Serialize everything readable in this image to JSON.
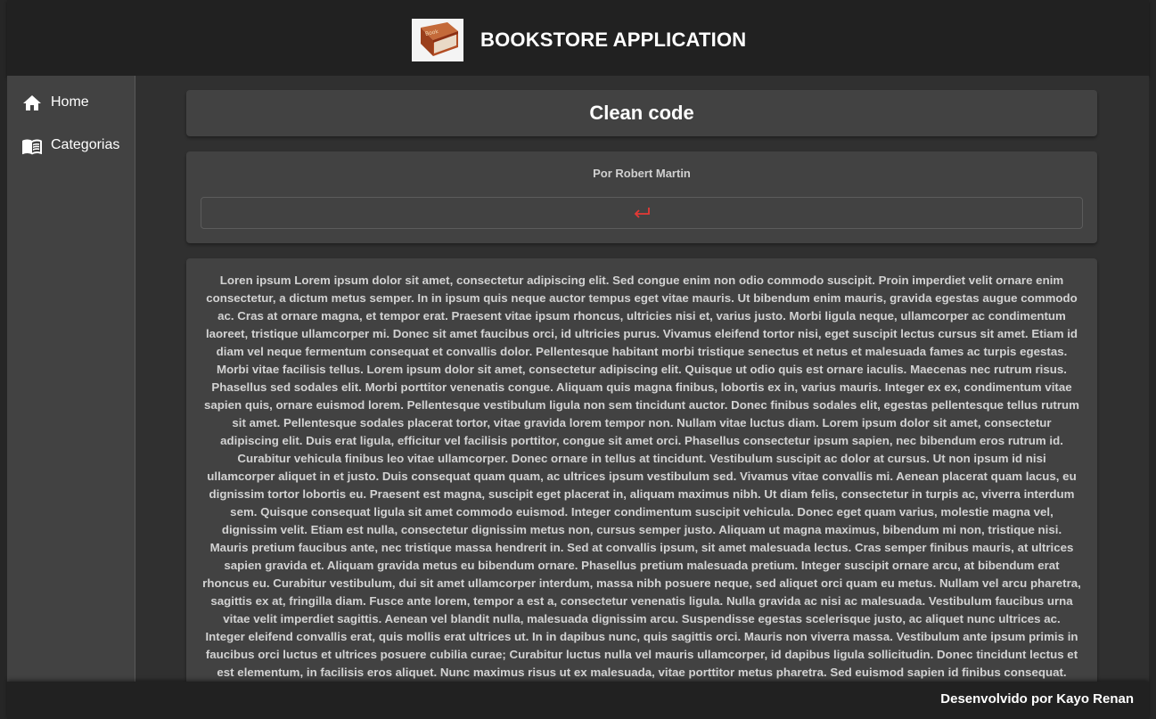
{
  "header": {
    "title": "BOOKSTORE APPLICATION",
    "logo_icon": "book-icon"
  },
  "sidebar": {
    "items": [
      {
        "label": "Home",
        "icon": "home-icon"
      },
      {
        "label": "Categorias",
        "icon": "menu-book-icon"
      }
    ]
  },
  "book": {
    "title": "Clean code",
    "author": "Por Robert Martin",
    "back_icon": "return-arrow-icon",
    "text": "Loren ipsum Lorem ipsum dolor sit amet, consectetur adipiscing elit. Sed congue enim non odio commodo suscipit. Proin imperdiet velit ornare enim consectetur, a dictum metus semper. In in ipsum quis neque auctor tempus eget vitae mauris. Ut bibendum enim mauris, gravida egestas augue commodo ac. Cras at ornare magna, et tempor erat. Praesent vitae ipsum rhoncus, ultricies nisi et, varius justo. Morbi ligula neque, ullamcorper ac condimentum laoreet, tristique ullamcorper mi. Donec sit amet faucibus orci, id ultricies purus. Vivamus eleifend tortor nisi, eget suscipit lectus cursus sit amet. Etiam id diam vel neque fermentum consequat et convallis dolor. Pellentesque habitant morbi tristique senectus et netus et malesuada fames ac turpis egestas. Morbi vitae facilisis tellus. Lorem ipsum dolor sit amet, consectetur adipiscing elit. Quisque ut odio quis est ornare iaculis. Maecenas nec rutrum risus. Phasellus sed sodales elit. Morbi porttitor venenatis congue. Aliquam quis magna finibus, lobortis ex in, varius mauris. Integer ex ex, condimentum vitae sapien quis, ornare euismod lorem. Pellentesque vestibulum ligula non sem tincidunt auctor. Donec finibus sodales elit, egestas pellentesque tellus rutrum sit amet. Pellentesque sodales placerat tortor, vitae gravida lorem tempor non. Nullam vitae luctus diam. Lorem ipsum dolor sit amet, consectetur adipiscing elit. Duis erat ligula, efficitur vel facilisis porttitor, congue sit amet orci. Phasellus consectetur ipsum sapien, nec bibendum eros rutrum id. Curabitur vehicula finibus leo vitae ullamcorper. Donec ornare in tellus at tincidunt. Vestibulum suscipit ac dolor at cursus. Ut non ipsum id nisi ullamcorper aliquet in et justo. Duis consequat quam quam, ac ultrices ipsum vestibulum sed. Vivamus vitae convallis mi. Aenean placerat quam lacus, eu dignissim tortor lobortis eu. Praesent est magna, suscipit eget placerat in, aliquam maximus nibh. Ut diam felis, consectetur in turpis ac, viverra interdum sem. Quisque consequat ligula sit amet commodo euismod. Integer condimentum suscipit vehicula. Donec eget quam varius, molestie magna vel, dignissim velit. Etiam est nulla, consectetur dignissim metus non, cursus semper justo. Aliquam ut magna maximus, bibendum mi non, tristique nisi. Mauris pretium faucibus ante, nec tristique massa hendrerit in. Sed at convallis ipsum, sit amet malesuada lectus. Cras semper finibus mauris, at ultrices sapien gravida et. Aliquam gravida metus eu bibendum ornare. Phasellus pretium malesuada pretium. Integer suscipit ornare arcu, at bibendum erat rhoncus eu. Curabitur vestibulum, dui sit amet ullamcorper interdum, massa nibh posuere neque, sed aliquet orci quam eu metus. Nullam vel arcu pharetra, sagittis ex at, fringilla diam. Fusce ante lorem, tempor a est a, consectetur venenatis ligula. Nulla gravida ac nisi ac malesuada. Vestibulum faucibus urna vitae velit imperdiet sagittis. Aenean vel blandit nulla, malesuada dignissim arcu. Suspendisse egestas scelerisque justo, ac aliquet nunc ultrices ac. Integer eleifend convallis erat, quis mollis erat ultrices ut. In in dapibus nunc, quis sagittis orci. Mauris non viverra massa. Vestibulum ante ipsum primis in faucibus orci luctus et ultrices posuere cubilia curae; Curabitur luctus nulla vel mauris ullamcorper, id dapibus ligula sollicitudin. Donec tincidunt lectus et est elementum, in facilisis eros aliquet. Nunc maximus risus ut ex malesuada, vitae porttitor metus pharetra. Sed euismod sapien id finibus consequat. Mauris ultricies nisl nec augue vehicula, sed luctus felis dapibus. Maecenas feugiat, ante id varius"
  },
  "footer": {
    "text": "Desenvolvido por Kayo Renan"
  },
  "colors": {
    "accent_back": "#e53935",
    "header_bg": "#212121",
    "sidebar_bg": "#424242",
    "card_bg": "#424242"
  }
}
